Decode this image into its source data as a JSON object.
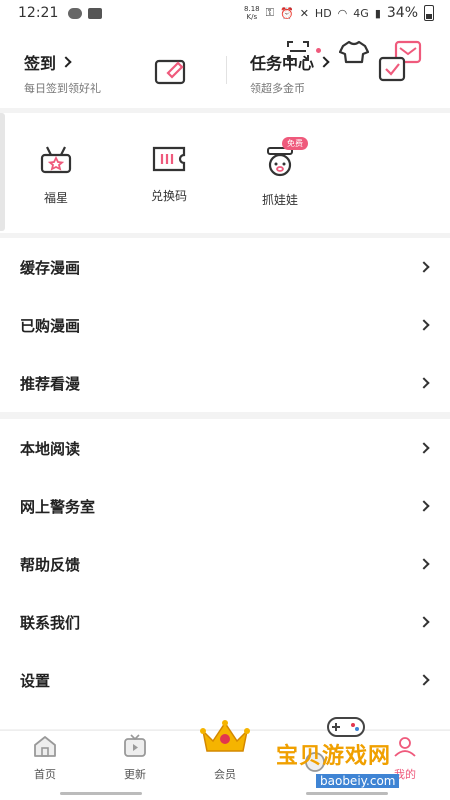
{
  "status_bar": {
    "time": "12:21",
    "speed_top": "8.18",
    "speed_bottom": "K/s",
    "network": "HD",
    "signal": "4G",
    "battery": "34%"
  },
  "top": {
    "checkin_title": "签到",
    "checkin_sub": "每日签到领好礼",
    "task_title": "任务中心",
    "task_sub": "领超多金币"
  },
  "quick": {
    "items": [
      {
        "label": "福星"
      },
      {
        "label": "兑换码"
      },
      {
        "label": "抓娃娃"
      }
    ],
    "badge": "免费"
  },
  "menu_group_1": [
    {
      "label": "缓存漫画"
    },
    {
      "label": "已购漫画"
    },
    {
      "label": "推荐看漫"
    }
  ],
  "menu_group_2": [
    {
      "label": "本地阅读"
    },
    {
      "label": "网上警务室"
    },
    {
      "label": "帮助反馈"
    },
    {
      "label": "联系我们"
    },
    {
      "label": "设置"
    }
  ],
  "tabs": [
    {
      "label": "首页"
    },
    {
      "label": "更新"
    },
    {
      "label": "会员"
    },
    {
      "label": ""
    },
    {
      "label": "我的"
    }
  ],
  "watermark": {
    "text": "宝贝游戏网",
    "url": "baobeiy.com"
  },
  "colors": {
    "accent": "#ef5a7c",
    "icon_stroke": "#333333"
  }
}
